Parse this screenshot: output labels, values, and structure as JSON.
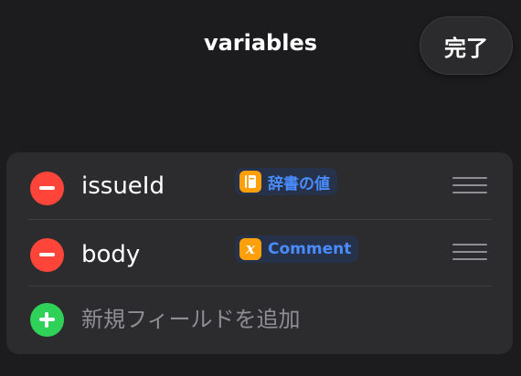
{
  "header": {
    "title": "variables",
    "done_label": "完了"
  },
  "fields": [
    {
      "name": "issueId",
      "value_label": "辞書の値",
      "value_icon": "dictionary-icon"
    },
    {
      "name": "body",
      "value_label": "Comment",
      "value_icon": "variable-x-icon"
    }
  ],
  "add_field_label": "新規フィールドを追加",
  "colors": {
    "remove": "#ff453a",
    "add": "#30d158",
    "token_text": "#4a8cff",
    "token_icon_bg": "#ff9f0a",
    "background": "#1c1c1e",
    "card": "#2c2c2e"
  }
}
